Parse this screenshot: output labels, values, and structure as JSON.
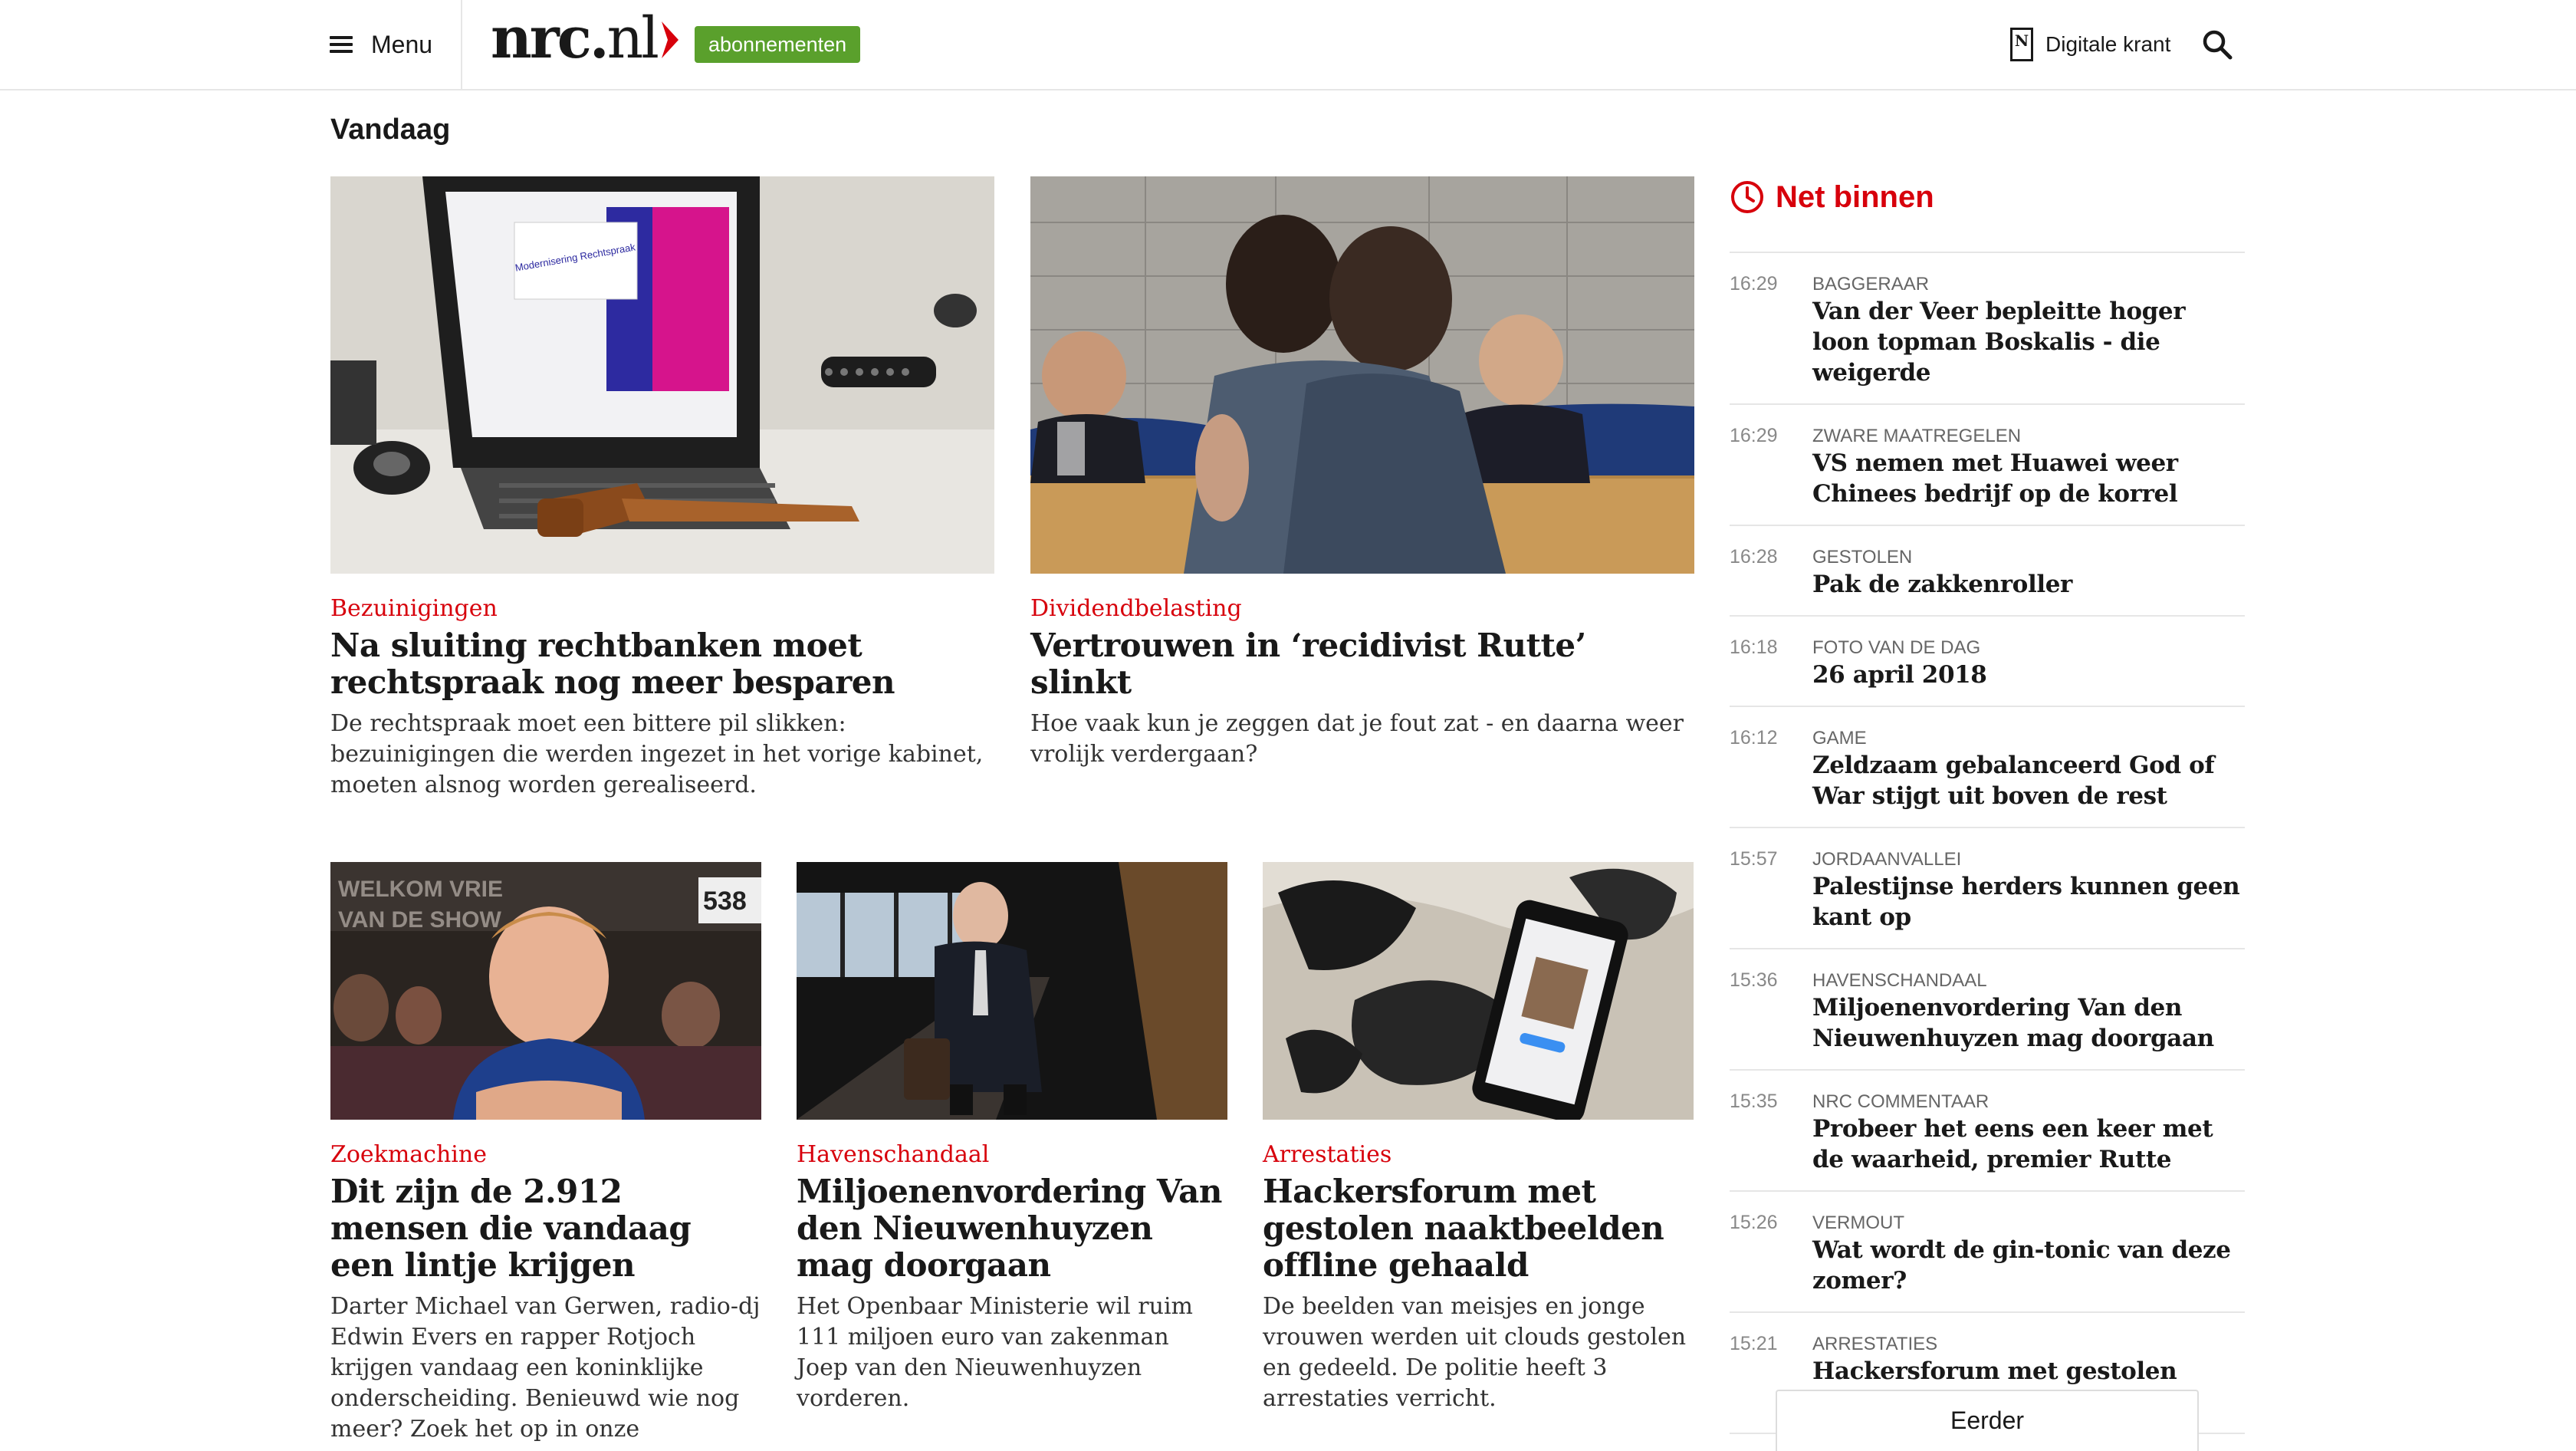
{
  "header": {
    "menu_label": "Menu",
    "logo_bold": "nrc.",
    "logo_light": "nl",
    "subscriptions_label": "abonnementen",
    "digital_paper_label": "Digitale krant",
    "accent_color": "#d7000b",
    "subscriptions_color": "#5aa02c"
  },
  "main": {
    "section_title": "Vandaag",
    "featured": [
      {
        "kicker": "Bezuinigingen",
        "headline": "Na sluiting rechtbanken moet rechtspraak nog meer besparen",
        "lead": "De rechtspraak moet een bittere pil slikken: bezuinigingen die werden ingezet in het vorige kabinet, moeten alsnog worden gerealiseerd.",
        "image_text": "Modernisering Rechtspraak"
      },
      {
        "kicker": "Dividendbelasting",
        "headline": "Vertrouwen in ‘recidivist Rutte’ slinkt",
        "lead": "Hoe vaak kun je zeggen dat je fout zat - en daarna weer vrolijk verdergaan?"
      }
    ],
    "secondary": [
      {
        "kicker": "Zoekmachine",
        "headline": "Dit zijn de 2.912 mensen die vandaag een lintje krijgen",
        "lead": "Darter Michael van Gerwen, radio-dj Edwin Evers en rapper Rotjoch krijgen vandaag een koninklijke onderscheiding. Benieuwd wie nog meer? Zoek het op in onze",
        "image_text_1": "WELKOM VRIE",
        "image_text_2": "VAN DE SHOW",
        "image_badge": "538"
      },
      {
        "kicker": "Havenschandaal",
        "headline": "Miljoenenvordering Van den Nieuwenhuyzen mag doorgaan",
        "lead": "Het Openbaar Ministerie wil ruim 111 miljoen euro van zakenman Joep van den Nieuwenhuyzen vorderen."
      },
      {
        "kicker": "Arrestaties",
        "headline": "Hackersforum met gestolen naaktbeelden offline gehaald",
        "lead": "De beelden van meisjes en jonge vrouwen werden uit clouds gestolen en gedeeld. De politie heeft 3 arrestaties verricht."
      }
    ]
  },
  "sidebar": {
    "title": "Net binnen",
    "items": [
      {
        "time": "16:29",
        "category": "Baggeraar",
        "title": "Van der Veer bepleitte hoger loon topman Boskalis - die weigerde"
      },
      {
        "time": "16:29",
        "category": "Zware maatregelen",
        "title": "VS nemen met Huawei weer Chinees bedrijf op de korrel"
      },
      {
        "time": "16:28",
        "category": "Gestolen",
        "title": "Pak de zakkenroller"
      },
      {
        "time": "16:18",
        "category": "Foto van de dag",
        "title": "26 april 2018"
      },
      {
        "time": "16:12",
        "category": "Game",
        "title": "Zeldzaam gebalanceerd God of War stijgt uit boven de rest"
      },
      {
        "time": "15:57",
        "category": "Jordaanvallei",
        "title": "Palestijnse herders kunnen geen kant op"
      },
      {
        "time": "15:36",
        "category": "Havenschandaal",
        "title": "Miljoenenvordering Van den Nieuwenhuyzen mag doorgaan"
      },
      {
        "time": "15:35",
        "category": "NRC Commentaar",
        "title": "Probeer het eens een keer met de waarheid, premier Rutte"
      },
      {
        "time": "15:26",
        "category": "Vermout",
        "title": "Wat wordt de gin-tonic van deze zomer?"
      },
      {
        "time": "15:21",
        "category": "Arrestaties",
        "title": "Hackersforum met gestolen naaktbeelden offline gehaald"
      }
    ],
    "more_label": "Eerder"
  }
}
